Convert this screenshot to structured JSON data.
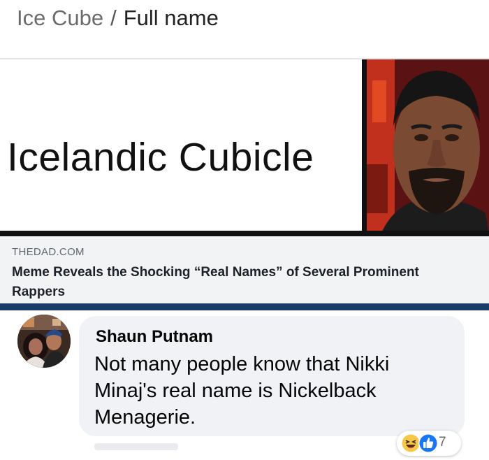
{
  "breadcrumb": {
    "part1": "Ice Cube",
    "separator": "/",
    "part2": "Full name"
  },
  "meme": {
    "text": "Icelandic Cubicle"
  },
  "link_preview": {
    "domain": "THEDAD.COM",
    "headline": "Meme Reveals the Shocking “Real Names” of Several Prominent Rappers"
  },
  "comment": {
    "author": "Shaun Putnam",
    "text": "Not many people know that Nikki Minaj's real name is Nickelback Menagerie."
  },
  "reactions": {
    "count": "7",
    "icons": [
      "haha-icon",
      "like-icon"
    ]
  },
  "colors": {
    "link_bg": "#f2f3f5",
    "divider_blue": "#1b3c6b",
    "bubble_bg": "#f0f2f5",
    "like_blue": "#1877f2",
    "haha_yellow": "#f7c74a"
  }
}
